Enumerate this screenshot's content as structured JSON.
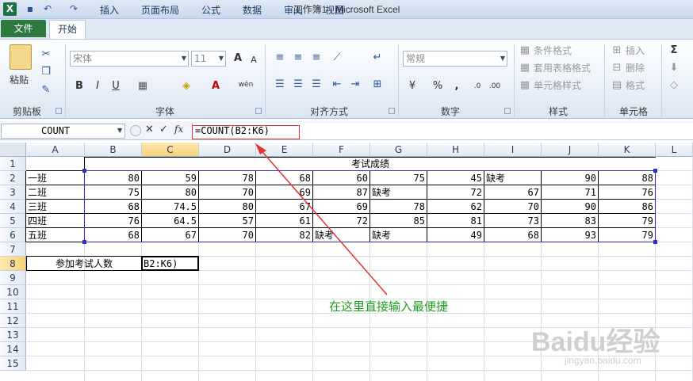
{
  "window": {
    "title": "工作簿1 - Microsoft Excel",
    "app_icon_letter": "X"
  },
  "qat": {
    "save_icon": "save-icon",
    "undo_icon": "undo-icon",
    "redo_icon": "redo-icon"
  },
  "tabs": [
    "文件",
    "开始",
    "插入",
    "页面布局",
    "公式",
    "数据",
    "审阅",
    "视图"
  ],
  "ribbon": {
    "clipboard": {
      "paste": "粘贴",
      "label": "剪贴板"
    },
    "font": {
      "name": "宋体",
      "size": "11",
      "label": "字体",
      "bold": "B",
      "italic": "I",
      "underline": "U",
      "grow": "A",
      "shrink": "A",
      "wen": "wén"
    },
    "align": {
      "label": "对齐方式"
    },
    "number": {
      "format": "常规",
      "label": "数字",
      "percent": "%",
      "comma": ","
    },
    "styles": {
      "conditional": "条件格式",
      "table": "套用表格格式",
      "cell": "单元格样式",
      "label": "样式"
    },
    "cells": {
      "insert": "插入",
      "delete": "删除",
      "format": "格式",
      "label": "单元格"
    },
    "editing": {
      "sum": "Σ"
    }
  },
  "formula_bar": {
    "name_box": "COUNT",
    "formula": "=COUNT(B2:K6)",
    "cancel": "✕",
    "enter": "✓",
    "fx": "fx"
  },
  "columns": [
    "A",
    "B",
    "C",
    "D",
    "E",
    "F",
    "G",
    "H",
    "I",
    "J",
    "K",
    "L"
  ],
  "rows": [
    "1",
    "2",
    "3",
    "4",
    "5",
    "6",
    "7",
    "8",
    "9",
    "10",
    "11",
    "12",
    "13",
    "14",
    "15"
  ],
  "sheet": {
    "title": "考试成绩",
    "data": [
      [
        "一班",
        "80",
        "59",
        "78",
        "68",
        "60",
        "75",
        "45",
        "缺考",
        "90",
        "88"
      ],
      [
        "二班",
        "75",
        "80",
        "70",
        "69",
        "87",
        "缺考",
        "72",
        "67",
        "71",
        "76"
      ],
      [
        "三班",
        "68",
        "74.5",
        "80",
        "67",
        "69",
        "78",
        "62",
        "70",
        "90",
        "86"
      ],
      [
        "四班",
        "76",
        "64.5",
        "57",
        "61",
        "72",
        "85",
        "81",
        "73",
        "83",
        "79"
      ],
      [
        "五班",
        "68",
        "67",
        "70",
        "82",
        "缺考",
        "缺考",
        "49",
        "68",
        "93",
        "79"
      ]
    ],
    "count_label": "参加考试人数",
    "active_cell_text": "B2:K6)"
  },
  "annotation": "在这里直接输入最便捷",
  "watermark": {
    "main": "Baidu经验",
    "sub": "jingyan.baidu.com"
  }
}
